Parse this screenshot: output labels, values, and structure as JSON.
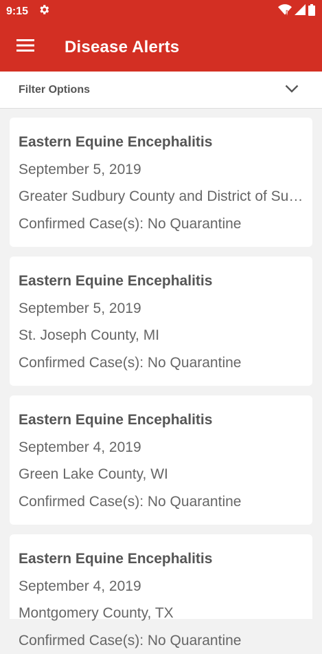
{
  "status_bar": {
    "time": "9:15",
    "icons": [
      "settings-gear-icon",
      "wifi-icon",
      "cellular-signal-icon",
      "battery-icon"
    ]
  },
  "app_bar": {
    "title": "Disease Alerts",
    "menu_icon": "hamburger-menu-icon"
  },
  "filter": {
    "label": "Filter Options",
    "icon": "chevron-down-icon"
  },
  "alerts": [
    {
      "disease": "Eastern Equine Encephalitis",
      "date": "September 5, 2019",
      "location": "Greater Sudbury County and District of Sudbury, ON",
      "status": "Confirmed Case(s): No Quarantine"
    },
    {
      "disease": "Eastern Equine Encephalitis",
      "date": "September 5, 2019",
      "location": "St. Joseph County, MI",
      "status": "Confirmed Case(s): No Quarantine"
    },
    {
      "disease": "Eastern Equine Encephalitis",
      "date": "September 4, 2019",
      "location": "Green Lake County, WI",
      "status": "Confirmed Case(s): No Quarantine"
    },
    {
      "disease": "Eastern Equine Encephalitis",
      "date": "September 4, 2019",
      "location": "Montgomery County, TX",
      "status": "Confirmed Case(s): No Quarantine"
    }
  ],
  "colors": {
    "brand_red": "#d32f23",
    "background": "#f2f2f2",
    "card": "#ffffff",
    "text": "#666666"
  }
}
